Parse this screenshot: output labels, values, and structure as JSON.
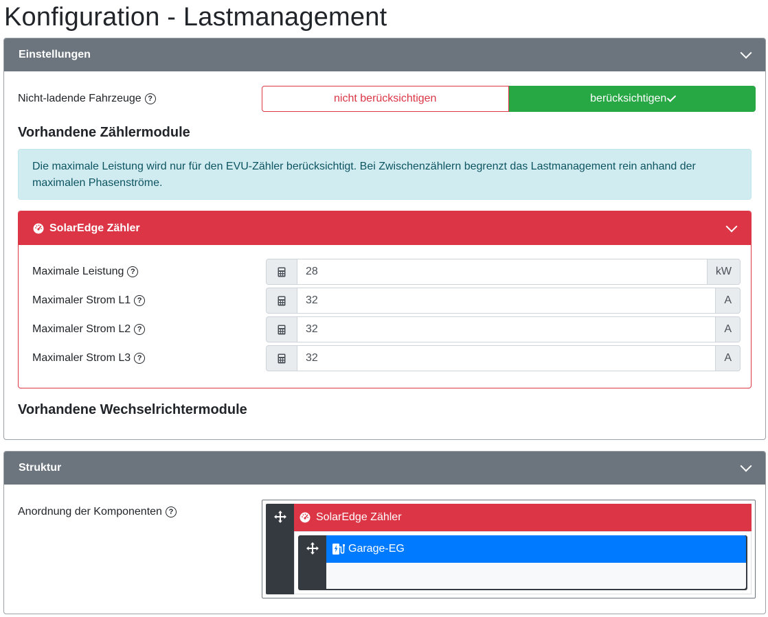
{
  "page": {
    "title": "Konfiguration - Lastmanagement"
  },
  "einstellungen": {
    "header": "Einstellungen",
    "non_charging": {
      "label": "Nicht-ladende Fahrzeuge",
      "options": [
        "nicht berücksichtigen",
        "berücksichtigen"
      ],
      "selected": "berücksichtigen"
    },
    "meters_heading": "Vorhandene Zählermodule",
    "info_text": "Die maximale Leistung wird nur für den EVU-Zähler berücksichtigt. Bei Zwischenzählern begrenzt das Lastmanagement rein anhand der maximalen Phasenströme.",
    "meter": {
      "name": "SolarEdge Zähler",
      "color": "#dc3545",
      "fields": [
        {
          "label": "Maximale Leistung",
          "value": "28",
          "unit": "kW"
        },
        {
          "label": "Maximaler Strom L1",
          "value": "32",
          "unit": "A"
        },
        {
          "label": "Maximaler Strom L2",
          "value": "32",
          "unit": "A"
        },
        {
          "label": "Maximaler Strom L3",
          "value": "32",
          "unit": "A"
        }
      ]
    },
    "inverters_heading": "Vorhandene Wechselrichtermodule"
  },
  "struktur": {
    "header": "Struktur",
    "arrangement_label": "Anordnung der Komponenten",
    "tree": {
      "root": {
        "name": "SolarEdge Zähler",
        "color": "#dc3545"
      },
      "child": {
        "name": "Garage-EG",
        "color": "#007bff"
      }
    }
  },
  "colors": {
    "header_gray": "#6c757d",
    "success": "#28a745",
    "danger": "#dc3545",
    "primary": "#007bff",
    "info_bg": "#d1ecf1"
  }
}
